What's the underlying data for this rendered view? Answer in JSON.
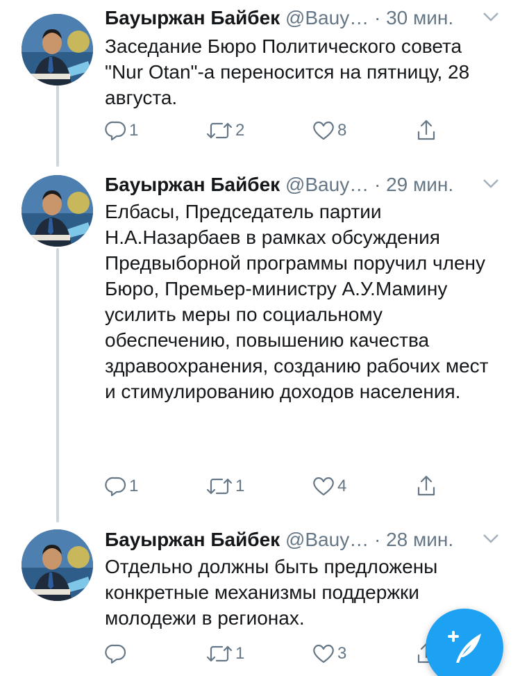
{
  "colors": {
    "accent": "#1da1f2",
    "secondary_text": "#657786",
    "thread_line": "#ccd6dd"
  },
  "tweets": [
    {
      "author_name": "Бауыржан Байбек",
      "handle": "@Bauy…",
      "separator": "·",
      "time": "30 мин.",
      "text": "Заседание Бюро Политического совета \"Nur Otan\"-а переносится на пятницу, 28 августа.",
      "replies": "1",
      "retweets": "2",
      "likes": "8"
    },
    {
      "author_name": "Бауыржан Байбек",
      "handle": "@Bauy…",
      "separator": "·",
      "time": "29 мин.",
      "text": "Елбасы, Председатель партии Н.А.Назарбаев в рамках обсуждения Предвыборной программы поручил члену Бюро, Премьер-министру А.У.Мамину усилить меры по социальному обеспечению, повышению качества здравоохранения, созданию рабочих мест и стимулированию доходов населения.",
      "replies": "1",
      "retweets": "1",
      "likes": "4"
    },
    {
      "author_name": "Бауыржан Байбек",
      "handle": "@Bauy…",
      "separator": "·",
      "time": "28 мин.",
      "text": "Отдельно должны быть предложены конкретные механизмы поддержки молодежи в регионах.",
      "replies": "",
      "retweets": "1",
      "likes": "3"
    }
  ],
  "icons": {
    "reply": "reply-icon",
    "retweet": "retweet-icon",
    "like": "heart-icon",
    "share": "share-icon",
    "more": "chevron-down-icon",
    "compose": "compose-tweet-icon"
  }
}
